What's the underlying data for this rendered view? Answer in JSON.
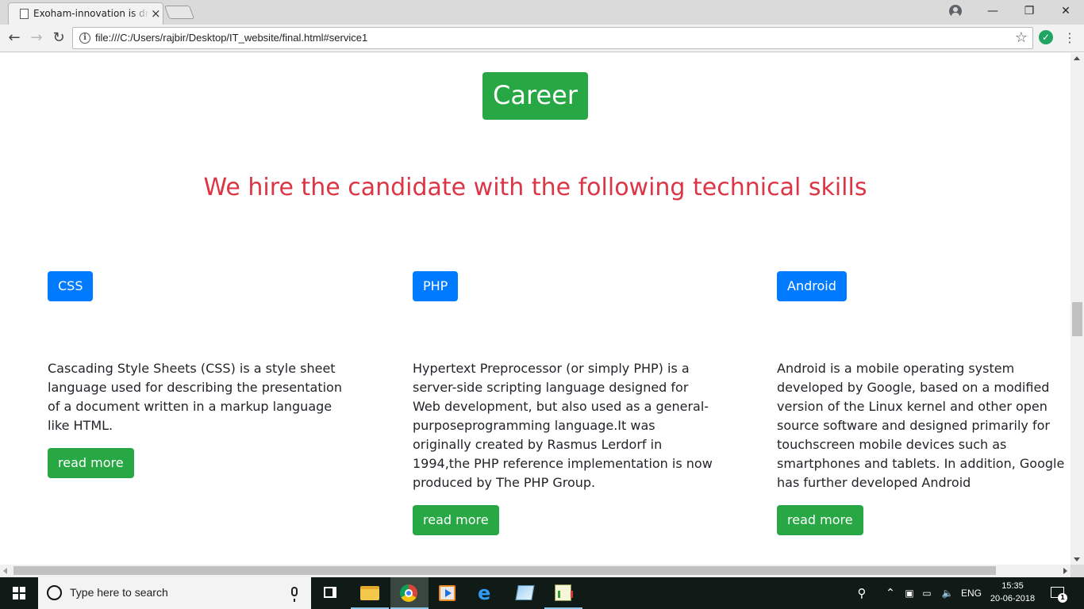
{
  "browser": {
    "tab_title": "Exoham-innovation is dre",
    "tab_close": "×",
    "url": "file:///C:/Users/rajbir/Desktop/IT_website/final.html#service1",
    "info_glyph": "i",
    "star_glyph": "☆",
    "ext_glyph": "✓",
    "menu_glyph": "⋮",
    "back_glyph": "←",
    "forward_glyph": "→",
    "reload_glyph": "↻",
    "minimize_glyph": "—",
    "restore_glyph": "❐",
    "close_glyph": "✕"
  },
  "page": {
    "badge": "Career",
    "headline": "We hire the candidate with the following technical skills",
    "skills": [
      {
        "name": "CSS",
        "description": "Cascading Style Sheets (CSS) is a style sheet language used for describing the presentation of a document written in a markup language like HTML.",
        "button": "read more"
      },
      {
        "name": "PHP",
        "description": "Hypertext Preprocessor (or simply PHP) is a server-side scripting language designed for Web development, but also used as a general-purposeprogramming language.It was originally created by Rasmus Lerdorf in 1994,the PHP reference implementation is now produced by The PHP Group.",
        "button": "read more"
      },
      {
        "name": "Android",
        "description": "Android is a mobile operating system developed by Google, based on a modified version of the Linux kernel and other open source software and designed primarily for touchscreen mobile devices such as smartphones and tablets. In addition, Google has further developed Android",
        "button": "read more"
      }
    ]
  },
  "taskbar": {
    "search_placeholder": "Type here to search",
    "edge_glyph": "e",
    "people_glyph": "⚲",
    "chevron_glyph": "⌃",
    "network_glyph": "▣",
    "battery_glyph": "▭",
    "volume_glyph": "🔈",
    "language": "ENG",
    "time": "15:35",
    "date": "20-06-2018",
    "notification_count": "1"
  },
  "colors": {
    "primary": "#007bff",
    "success": "#28a745",
    "danger": "#dc3545"
  }
}
